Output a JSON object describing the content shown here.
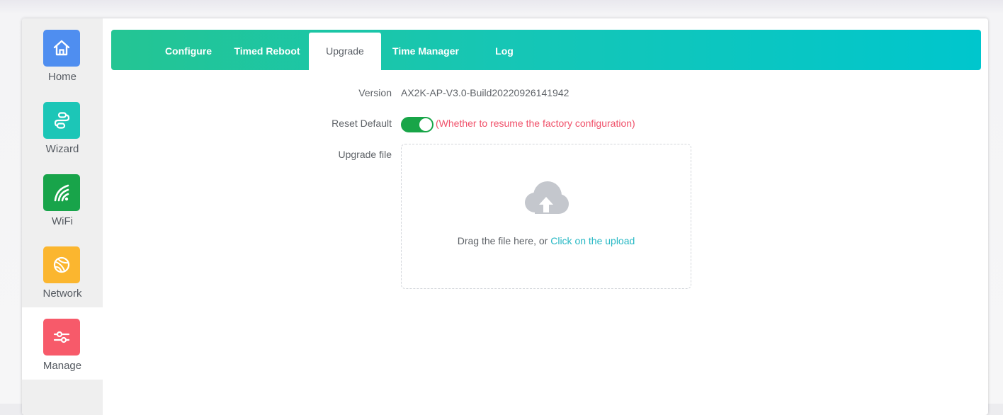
{
  "sidebar": {
    "items": [
      {
        "label": "Home",
        "icon": "home-icon",
        "color": "#4f8ef0"
      },
      {
        "label": "Wizard",
        "icon": "wizard-icon",
        "color": "#1cc6b7"
      },
      {
        "label": "WiFi",
        "icon": "wifi-icon",
        "color": "#18a44a"
      },
      {
        "label": "Network",
        "icon": "globe-icon",
        "color": "#fbb62f"
      },
      {
        "label": "Manage",
        "icon": "sliders-icon",
        "color": "#f75a6a"
      }
    ],
    "active": "Manage"
  },
  "tabs": {
    "items": [
      {
        "label": "Configure"
      },
      {
        "label": "Timed Reboot"
      },
      {
        "label": "Upgrade"
      },
      {
        "label": "Time Manager"
      },
      {
        "label": "Log"
      }
    ],
    "active": "Upgrade"
  },
  "form": {
    "version_label": "Version",
    "version_value": "AX2K-AP-V3.0-Build20220926141942",
    "reset_label": "Reset Default",
    "reset_enabled": true,
    "reset_hint": "(Whether to resume the factory configuration)",
    "upgrade_label": "Upgrade file",
    "drop_text": "Drag the file here, or",
    "drop_link": "Click on the upload"
  },
  "colors": {
    "accent_gradient_start": "#24c593",
    "accent_gradient_end": "#00c6cd",
    "toggle_on": "#18a548",
    "hint": "#f0516a",
    "link": "#27b8c4"
  }
}
